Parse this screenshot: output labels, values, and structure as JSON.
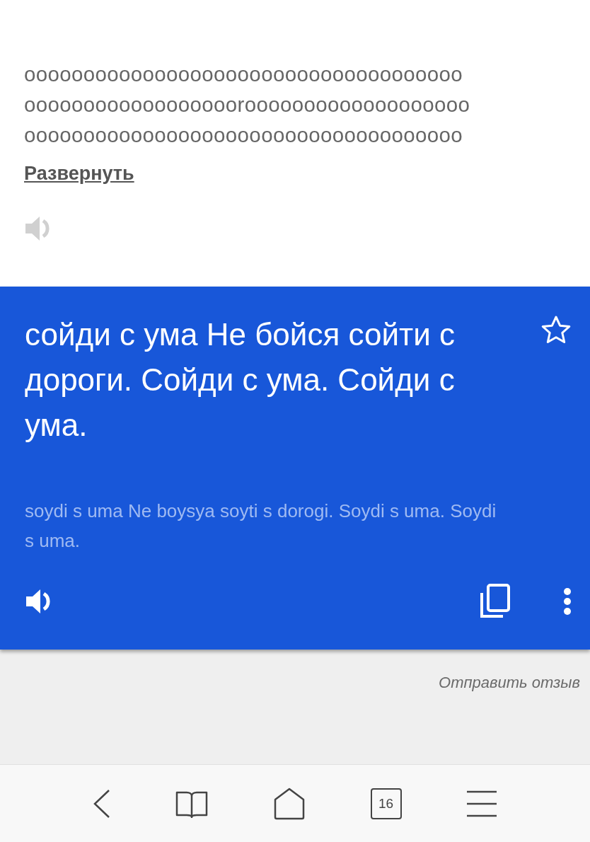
{
  "source": {
    "lines": [
      "ooooooooooooooooooooooooooooooooooooo",
      "oooooooooooooooooorooooooooooooooooooo",
      "ooooooooooooooooooooooooooooooooooooo"
    ],
    "expand_link": "Развернуть"
  },
  "translation": {
    "text": "сойди с ума Не бойся сойти с дороги. Сойди с ума. Сойди с ума.",
    "transliteration": "soydi s uma Ne boysya soyti s dorogi. Soydi s uma. Soydi s uma.",
    "starred": false
  },
  "feedback_link": "Отправить отзыв",
  "nav": {
    "tab_count": "16"
  }
}
